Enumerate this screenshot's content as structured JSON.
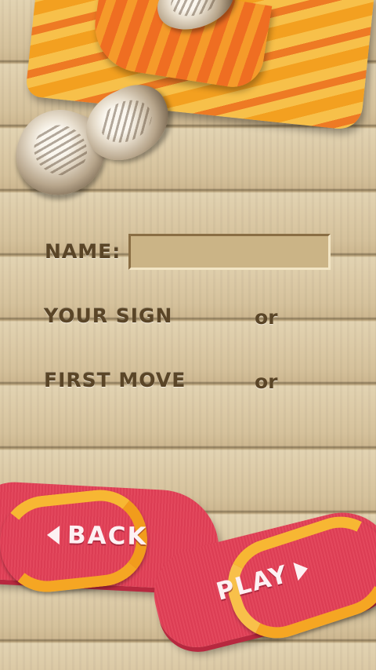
{
  "form": {
    "name_label": "NAME:",
    "name_value": "",
    "sign_label": "YOUR SIGN",
    "sign_or": "or",
    "move_label": "FIRST MOVE",
    "move_or": "or"
  },
  "buttons": {
    "back_label": "BACK",
    "play_label": "PLAY"
  },
  "colors": {
    "label_brown": "#5a4527",
    "flipflop_red": "#e3485d",
    "strap_orange": "#f5a623",
    "towel_orange": "#ee7a24"
  }
}
